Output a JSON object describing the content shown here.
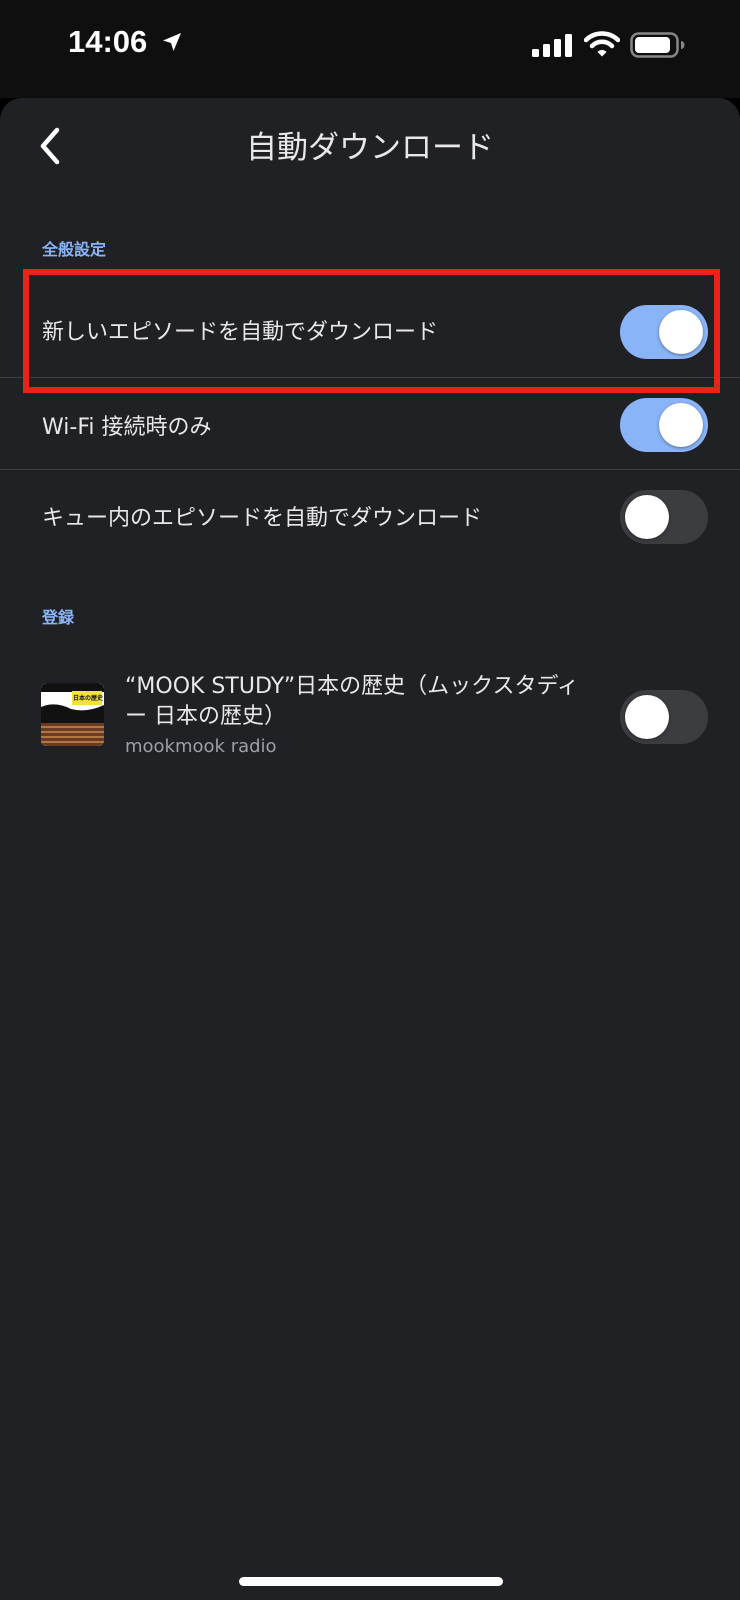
{
  "status_bar": {
    "time": "14:06",
    "icons": [
      "location-arrow-icon",
      "cellular-signal-icon",
      "wifi-icon",
      "battery-icon"
    ]
  },
  "header": {
    "back_icon": "chevron-left-icon",
    "title": "自動ダウンロード"
  },
  "general": {
    "section_label": "全般設定",
    "settings": [
      {
        "label": "新しいエピソードを自動でダウンロード",
        "enabled": true
      },
      {
        "label": "Wi-Fi 接続時のみ",
        "enabled": true
      },
      {
        "label": "キュー内のエピソードを自動でダウンロード",
        "enabled": false
      }
    ]
  },
  "subscriptions": {
    "section_label": "登録",
    "podcasts": [
      {
        "title": "“MOOK STUDY”日本の歴史（ムックスタディー 日本の歴史）",
        "author": "mookmook radio",
        "enabled": false,
        "artwork_text": "日本の歴史"
      }
    ]
  },
  "colors": {
    "accent": "#8ab4f8",
    "background": "#202124",
    "highlight": "#e8241a",
    "toggle_off": "#3c3d40"
  }
}
